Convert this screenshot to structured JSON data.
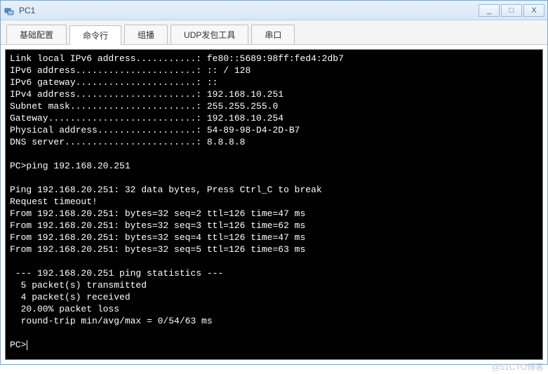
{
  "window": {
    "title": "PC1",
    "min_glyph": "_",
    "max_glyph": "□",
    "close_glyph": "X"
  },
  "tabs": [
    {
      "id": "basic",
      "label": "基础配置",
      "active": false
    },
    {
      "id": "cli",
      "label": "命令行",
      "active": true
    },
    {
      "id": "mcast",
      "label": "组播",
      "active": false
    },
    {
      "id": "udp",
      "label": "UDP发包工具",
      "active": false
    },
    {
      "id": "serial",
      "label": "串口",
      "active": false
    }
  ],
  "terminal": {
    "config_lines": [
      "Link local IPv6 address...........: fe80::5689:98ff:fed4:2db7",
      "IPv6 address......................: :: / 128",
      "IPv6 gateway......................: ::",
      "IPv4 address......................: 192.168.10.251",
      "Subnet mask.......................: 255.255.255.0",
      "Gateway...........................: 192.168.10.254",
      "Physical address..................: 54-89-98-D4-2D-B7",
      "DNS server........................: 8.8.8.8"
    ],
    "command_prompt": "PC>",
    "command": "ping 192.168.20.251",
    "ping_header": "Ping 192.168.20.251: 32 data bytes, Press Ctrl_C to break",
    "timeout_line": "Request timeout!",
    "replies": [
      "From 192.168.20.251: bytes=32 seq=2 ttl=126 time=47 ms",
      "From 192.168.20.251: bytes=32 seq=3 ttl=126 time=62 ms",
      "From 192.168.20.251: bytes=32 seq=4 ttl=126 time=47 ms",
      "From 192.168.20.251: bytes=32 seq=5 ttl=126 time=63 ms"
    ],
    "stats_header": " --- 192.168.20.251 ping statistics ---",
    "stats_lines": [
      "  5 packet(s) transmitted",
      "  4 packet(s) received",
      "  20.00% packet loss",
      "  round-trip min/avg/max = 0/54/63 ms"
    ],
    "final_prompt": "PC>"
  },
  "watermark": "@51CTO博客"
}
